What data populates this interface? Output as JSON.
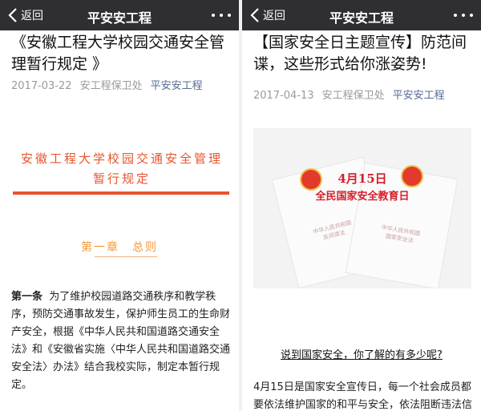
{
  "left": {
    "nav": {
      "back_label": "返回",
      "title": "平安安工程"
    },
    "article": {
      "title": "《安徽工程大学校园交通安全管理暂行规定 》",
      "date": "2017-03-22",
      "author": "安工程保卫处",
      "account": "平安安工程"
    },
    "doc": {
      "heading": "安徽工程大学校园交通安全管理暂行规定",
      "chapter": "第一章　总则",
      "clause_label": "第一条",
      "clause_text": "为了维护校园道路交通秩序和教学秩序，预防交通事故发生，保护师生员工的生命财产安全，根据《中华人民共和国道路交通安全法》和《安徽省实施〈中华人民共和国道路交通安全法〉办法》结合我校实际，制定本暂行规定。"
    }
  },
  "right": {
    "nav": {
      "back_label": "返回",
      "title": "平安安工程"
    },
    "article": {
      "title": "【国家安全日主题宣传】防范间谍，这些形式给你涨姿势!",
      "date": "2017-04-13",
      "author": "安工程保卫处",
      "account": "平安安工程"
    },
    "image": {
      "date_text": "4月15日",
      "event_text": "全民国家安全教育日",
      "law_left": "中华人民共和国\n反间谍法",
      "law_right": "中华人民共和国\n国家安全法"
    },
    "caption": "说到国家安全，你了解的有多少呢?",
    "body": "4月15日是国家安全宣传日，每一个社会成员都要依法维护国家的和平与安全，依法阻断违法信"
  },
  "colors": {
    "navbar": "#2e2e33",
    "link": "#576b95",
    "accent_red": "#e8542e",
    "accent_orange": "#f29a3b"
  },
  "icons": {
    "back": "chevron-left-icon",
    "more": "more-dots-icon"
  }
}
